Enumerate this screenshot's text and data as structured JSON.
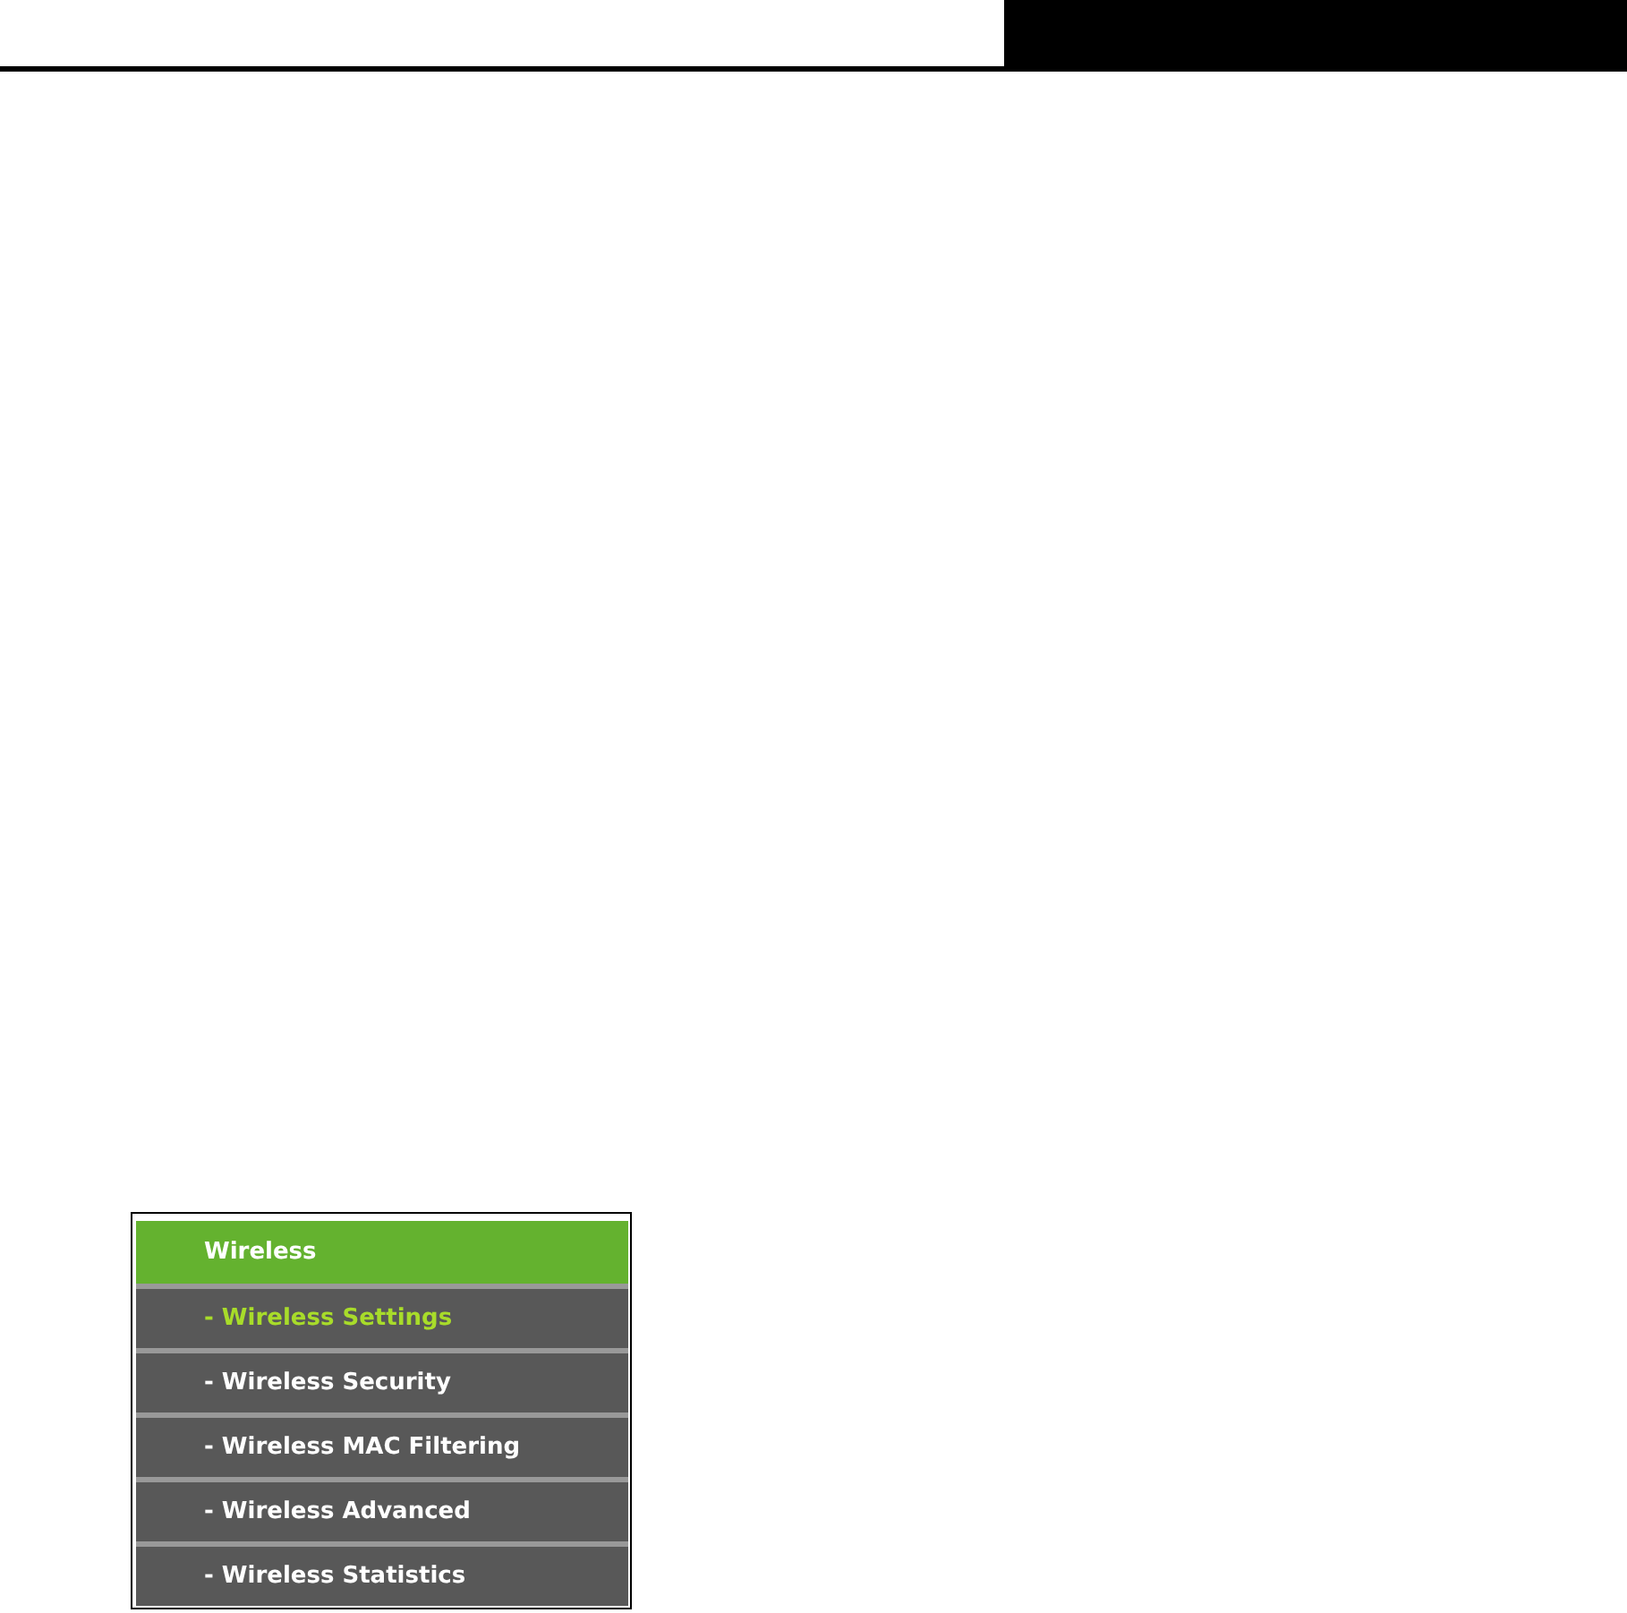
{
  "menu": {
    "title": "Wireless",
    "items": [
      {
        "label": "- Wireless Settings",
        "selected": true
      },
      {
        "label": "- Wireless Security",
        "selected": false
      },
      {
        "label": "- Wireless MAC Filtering",
        "selected": false
      },
      {
        "label": "- Wireless Advanced",
        "selected": false
      },
      {
        "label": "- Wireless Statistics",
        "selected": false
      }
    ]
  }
}
